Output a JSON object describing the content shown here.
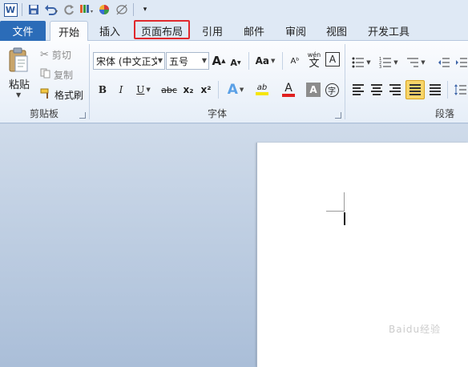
{
  "qat": {
    "app_icon": "word-icon",
    "items": [
      "save-icon",
      "undo-icon",
      "redo-icon",
      "format-painter-icon",
      "color-icon",
      "sign-icon",
      "customize-icon"
    ]
  },
  "tabs": {
    "file": "文件",
    "items": [
      "开始",
      "插入",
      "页面布局",
      "引用",
      "邮件",
      "审阅",
      "视图",
      "开发工具"
    ],
    "active_index": 0,
    "highlighted_index": 2
  },
  "clipboard": {
    "paste": "粘贴",
    "cut": "剪切",
    "copy": "复制",
    "format_painter": "格式刷",
    "group_label": "剪贴板"
  },
  "font": {
    "font_name": "宋体 (中文正文",
    "font_size": "五号",
    "grow": "A",
    "shrink": "A",
    "change_case": "Aa",
    "clear_format": "Aᵇ",
    "phonetic": "wén",
    "phonetic_char": "文",
    "border_char": "A",
    "bold": "B",
    "italic": "I",
    "underline": "U",
    "strike": "abc",
    "subscript": "x₂",
    "superscript": "x²",
    "effects": "A",
    "highlight": "ab",
    "font_color": "A",
    "shading": "A",
    "enclose": "字",
    "group_label": "字体",
    "font_color_hex": "#e02020",
    "highlight_hex": "#f5e50a"
  },
  "paragraph": {
    "group_label": "段落"
  },
  "document": {
    "watermark": "Baidu经验"
  }
}
